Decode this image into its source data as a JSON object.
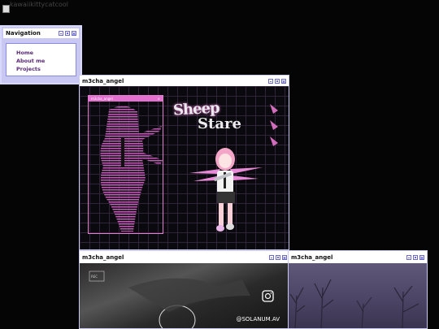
{
  "broken_image_alt": "kawaiikittycatcool",
  "navigation": {
    "title": "Navigation",
    "links": [
      "Home",
      "About me",
      "Projects"
    ]
  },
  "main_window": {
    "title": "m3cha_angel",
    "inner_window_title": "m3cha_angel",
    "logo_line1": "Sheep",
    "logo_line2": "Stare"
  },
  "bottom_left_window": {
    "title": "m3cha_angel",
    "handle": "@SOLANUM.AV",
    "rec_label": "REC"
  },
  "bottom_right_window": {
    "title": "m3cha_angel"
  },
  "colors": {
    "accent": "#c8c8f2",
    "pink": "#e36fcf",
    "background": "#050505"
  }
}
